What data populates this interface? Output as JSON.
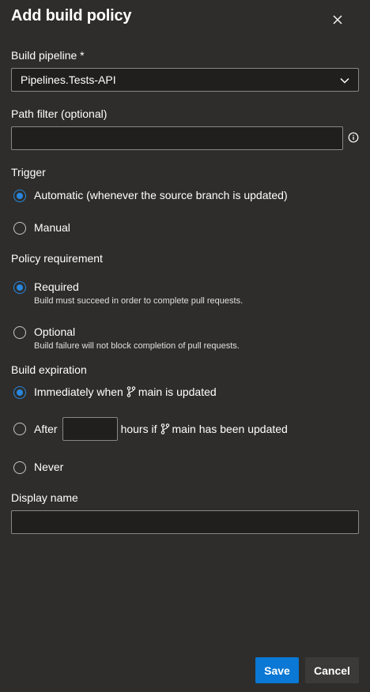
{
  "dialog": {
    "title": "Add build policy"
  },
  "pipeline": {
    "label": "Build pipeline *",
    "value": "Pipelines.Tests-API"
  },
  "path_filter": {
    "label": "Path filter (optional)",
    "value": ""
  },
  "trigger": {
    "label": "Trigger",
    "options": [
      {
        "label": "Automatic (whenever the source branch is updated)",
        "selected": true
      },
      {
        "label": "Manual",
        "selected": false
      }
    ]
  },
  "requirement": {
    "label": "Policy requirement",
    "options": [
      {
        "label": "Required",
        "description": "Build must succeed in order to complete pull requests.",
        "selected": true
      },
      {
        "label": "Optional",
        "description": "Build failure will not block completion of pull requests.",
        "selected": false
      }
    ]
  },
  "expiration": {
    "label": "Build expiration",
    "immediately_prefix": "Immediately when",
    "immediately_suffix": "main is updated",
    "after_prefix": "After",
    "after_middle": "hours if",
    "after_suffix": "main has been updated",
    "hours_value": "",
    "never": "Never"
  },
  "display_name": {
    "label": "Display name",
    "value": ""
  },
  "footer": {
    "save": "Save",
    "cancel": "Cancel"
  },
  "colors": {
    "accent": "#0a78d4",
    "radio": "#2886de",
    "background": "#2e2d2b",
    "input_bg": "#201f1e"
  }
}
